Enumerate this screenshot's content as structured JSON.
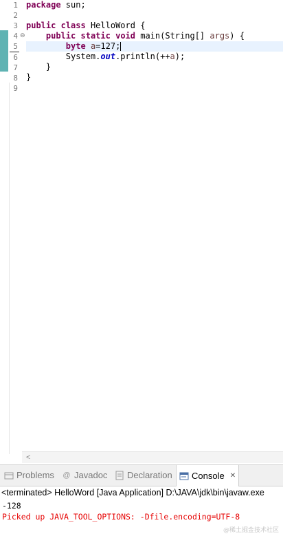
{
  "editor": {
    "line_numbers": [
      "1",
      "2",
      "3",
      "4",
      "5",
      "6",
      "7",
      "8",
      "9"
    ],
    "current_line": "5",
    "code": {
      "l1_kw": "package",
      "l1_rest": " sun;",
      "l3_kw1": "public",
      "l3_kw2": "class",
      "l3_rest": " HelloWord {",
      "l4_indent": "    ",
      "l4_kw1": "public",
      "l4_kw2": "static",
      "l4_kw3": "void",
      "l4_rest1": " main(String[] ",
      "l4_var": "args",
      "l4_rest2": ") {",
      "l5_indent": "        ",
      "l5_kw": "byte",
      "l5_var": "a",
      "l5_rest": "=127;",
      "l6_text1": "        System.",
      "l6_field": "out",
      "l6_text2": ".println(++",
      "l6_var": "a",
      "l6_text3": ");",
      "l7_text": "    }",
      "l8_text": "}"
    }
  },
  "tabs": [
    {
      "label": "Problems",
      "icon": "problems-icon"
    },
    {
      "label": "Javadoc",
      "icon": "at-icon"
    },
    {
      "label": "Declaration",
      "icon": "declaration-icon"
    },
    {
      "label": "Console",
      "icon": "console-icon",
      "active": true
    }
  ],
  "tab_close_glyph": "✕",
  "console": {
    "header": "<terminated> HelloWord [Java Application] D:\\JAVA\\jdk\\bin\\javaw.exe",
    "output_lines": [
      "-128"
    ],
    "error_line": "Picked up JAVA_TOOL_OPTIONS: -Dfile.encoding=UTF-8"
  },
  "watermark": "@稀土掘金技术社区",
  "colors": {
    "keyword": "#7f0055",
    "field": "#0000c0",
    "error": "#e60000",
    "current_line_bg": "#e8f2fe"
  }
}
